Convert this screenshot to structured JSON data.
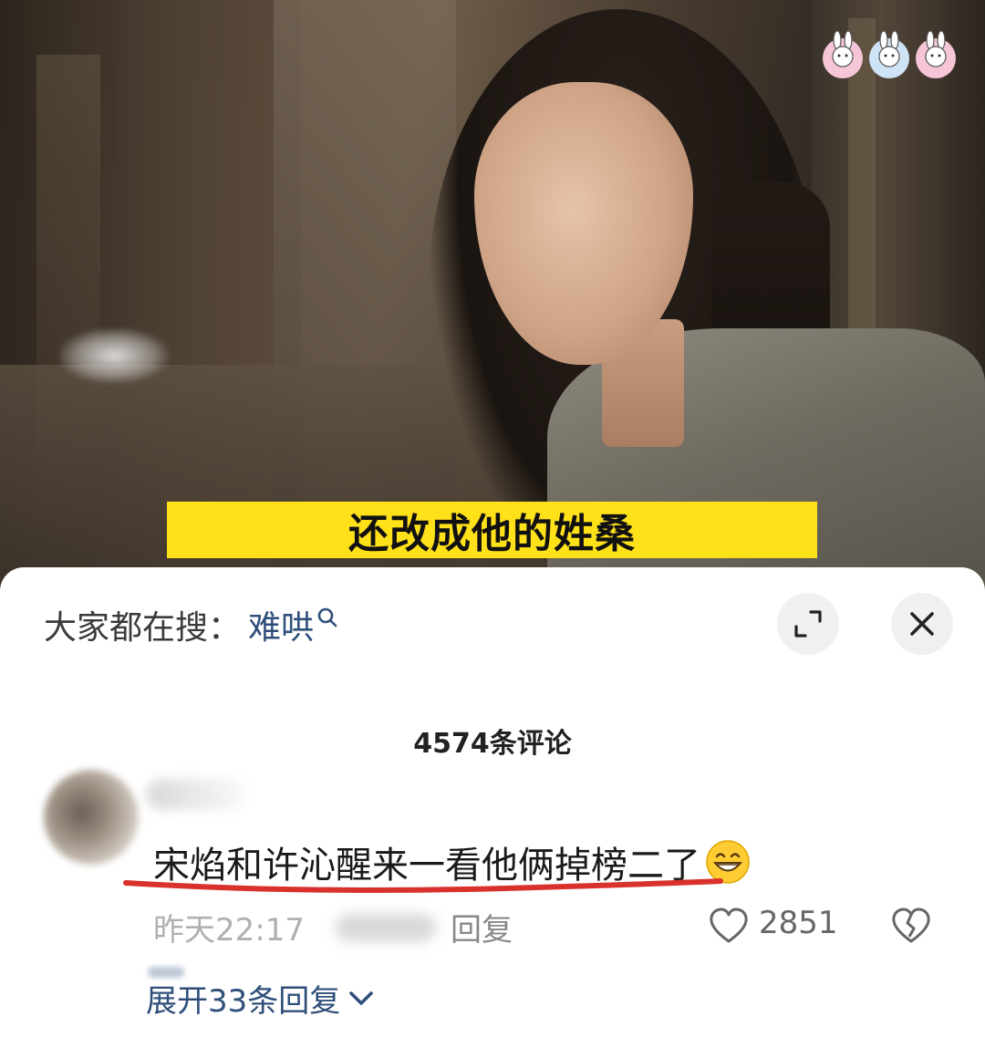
{
  "video": {
    "subtitle": "还改成他的姓桑"
  },
  "search_bar": {
    "prefix": "大家都在搜：",
    "term": "难哄"
  },
  "comments": {
    "count_label": "4574条评论",
    "items": [
      {
        "text": "宋焰和许沁醒来一看他俩掉榜二了",
        "time": "昨天22:17",
        "reply_label": "回复",
        "likes": "2851",
        "expand_label": "展开33条回复"
      }
    ]
  },
  "colors": {
    "subtitle_bg": "#ffe11a",
    "link_blue": "#2f4f7a",
    "underline_red": "#d9312b"
  },
  "icons": {
    "watermark": "bunny-stickers-icon",
    "search": "search-icon",
    "expand": "expand-icon",
    "close": "close-icon",
    "emoji": "grin-emoji-icon",
    "like": "heart-outline-icon",
    "dislike": "broken-heart-icon",
    "chevron": "chevron-down-icon"
  }
}
